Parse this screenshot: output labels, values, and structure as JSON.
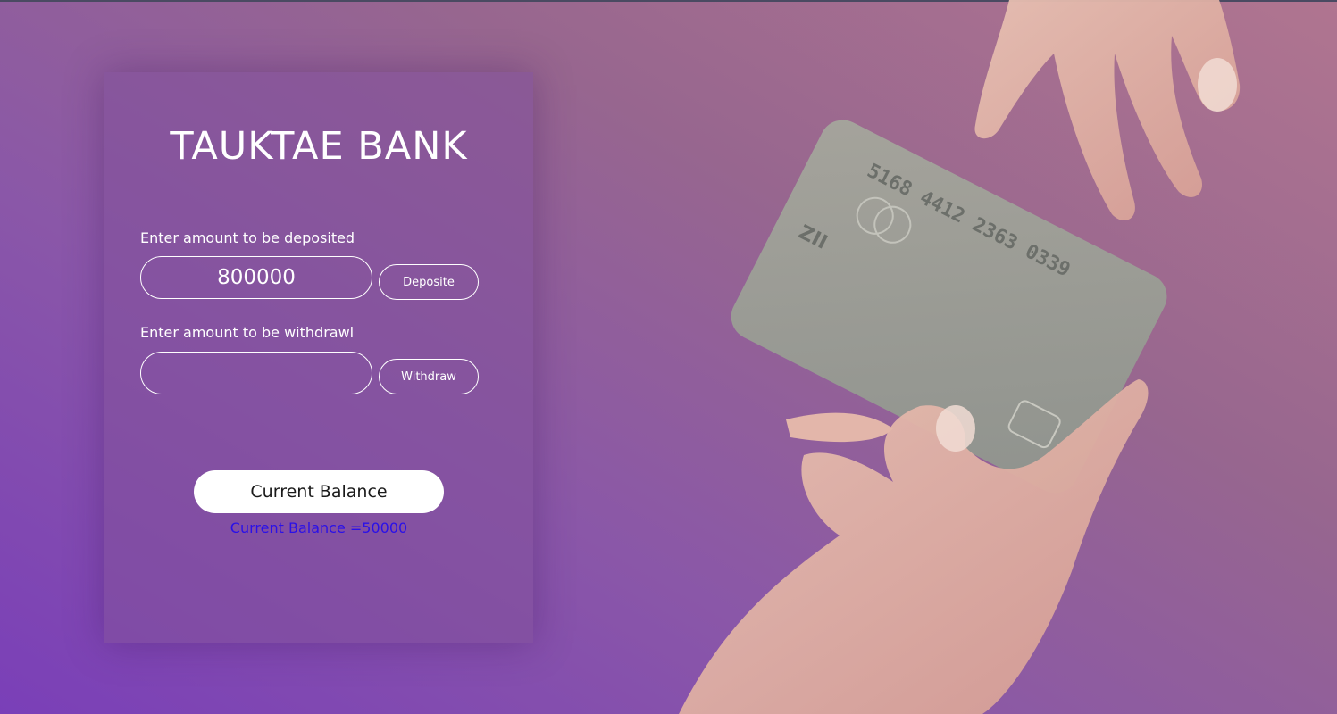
{
  "bank": {
    "title": "TAUKTAE BANK"
  },
  "deposit": {
    "label": "Enter amount to be deposited",
    "value": "800000",
    "button_label": "Deposite"
  },
  "withdraw": {
    "label": "Enter amount to be withdrawl",
    "value": "",
    "button_label": "Withdraw"
  },
  "balance": {
    "button_label": "Current Balance",
    "result_text": "Current Balance =50000"
  },
  "card": {
    "number": "5168 4412 2363 0339",
    "mark": "ZII"
  },
  "colors": {
    "accent_text": "#2a10e8",
    "panel": "#82509b",
    "background_start": "#7a3fb8",
    "background_end": "#b07590"
  }
}
